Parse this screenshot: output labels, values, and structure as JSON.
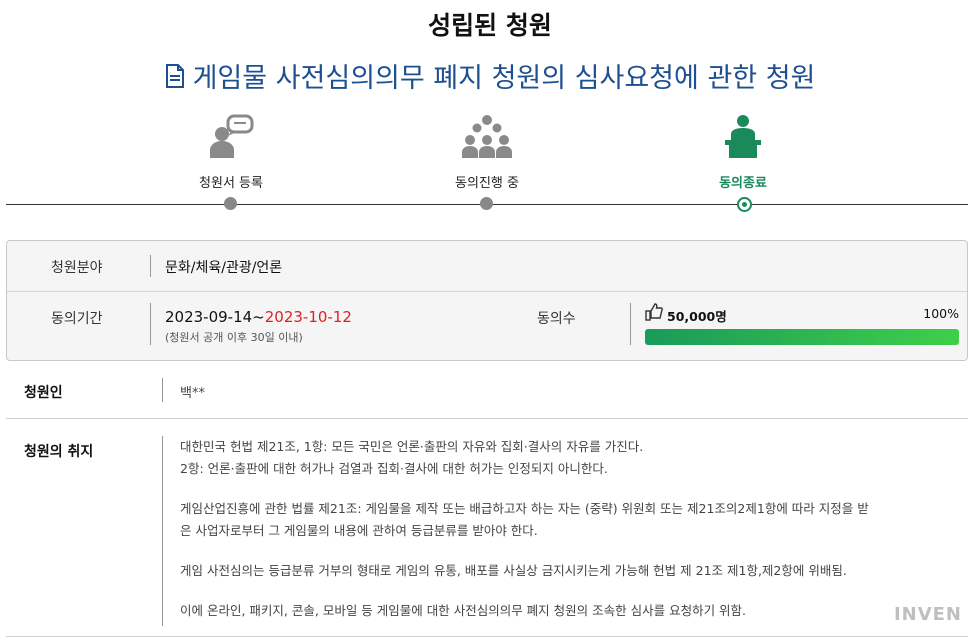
{
  "status_title": "성립된 청원",
  "petition_title": "게임물 사전심의의무 폐지 청원의 심사요청에 관한 청원",
  "steps": [
    {
      "label": "청원서 등록",
      "icon": "speech-person-icon"
    },
    {
      "label": "동의진행 중",
      "icon": "crowd-icon"
    },
    {
      "label": "동의종료",
      "icon": "podium-speaker-icon"
    }
  ],
  "info": {
    "category_label": "청원분야",
    "category_value": "문화/체육/관광/언론",
    "period_label": "동의기간",
    "period_start": "2023-09-14~",
    "period_end": "2023-10-12",
    "period_note": "(청원서 공개 이후 30일 이내)",
    "count_label": "동의수",
    "count_value": "50,000명",
    "count_percent": "100%",
    "progress": 1.0
  },
  "petitioner": {
    "label": "청원인",
    "value": "백**"
  },
  "purpose": {
    "label": "청원의 취지",
    "paragraphs": [
      [
        "대한민국 헌법 제21조, 1항: 모든 국민은 언론·출판의 자유와 집회·결사의 자유를 가진다.",
        "2항: 언론·출판에 대한 허가나 검열과 집회·결사에 대한 허가는 인정되지 아니한다."
      ],
      [
        "게임산업진흥에 관한 법률 제21조: 게임물을 제작 또는 배급하고자 하는 자는 (중략) 위원회 또는 제21조의2제1항에 따라 지정을 받",
        "은 사업자로부터 그 게임물의 내용에 관하여 등급분류를 받아야 한다."
      ],
      [
        "게임 사전심의는 등급분류 거부의 형태로 게임의 유통, 배포를 사실상 금지시키는게 가능해 헌법 제 21조 제1항,제2항에 위배됨."
      ],
      [
        "이에 온라인, 패키지, 콘솔, 모바일 등 게임물에 대한 사전심의의무 폐지 청원의 조속한 심사를 요청하기 위함."
      ]
    ]
  },
  "watermark": "INVEN",
  "colors": {
    "title_blue": "#1d4f91",
    "accent_green": "#1a8a5a",
    "deadline_red": "#e02020"
  }
}
